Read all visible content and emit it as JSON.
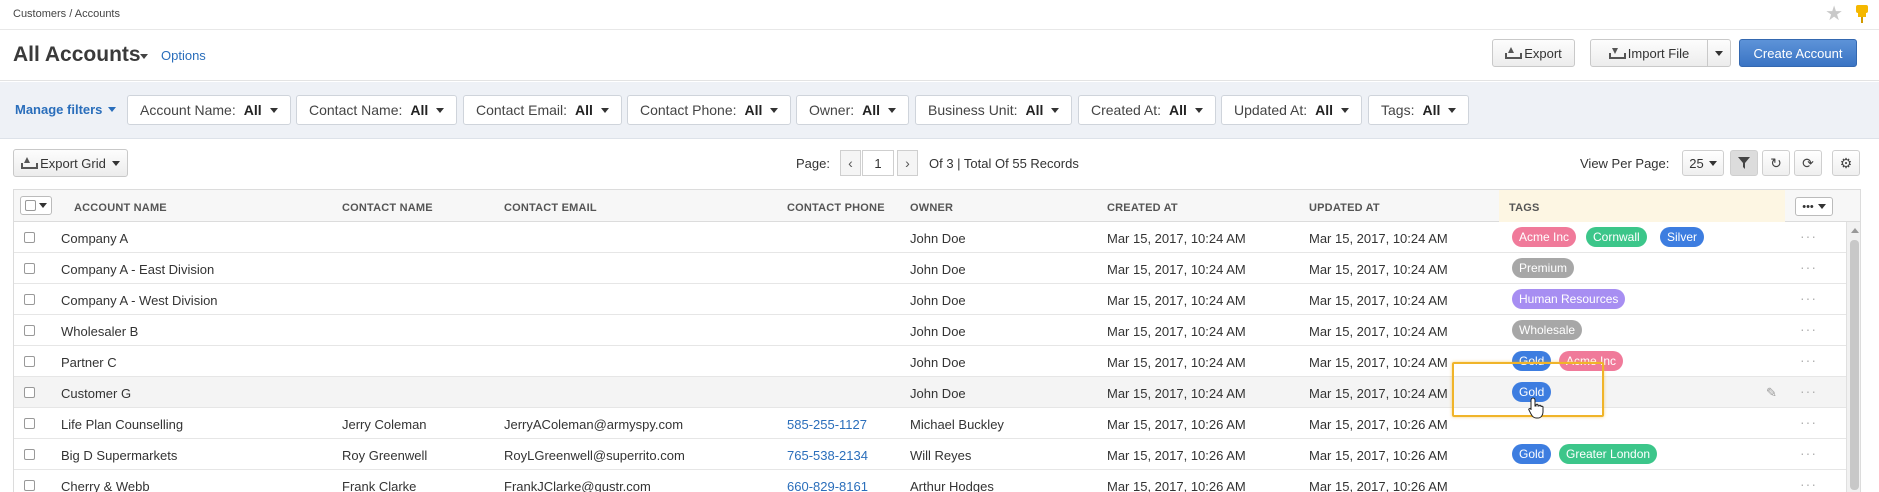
{
  "breadcrumb": "Customers / Accounts",
  "page": {
    "title": "All Accounts",
    "options_label": "Options"
  },
  "actions": {
    "export_label": "Export",
    "import_label": "Import File",
    "create_label": "Create Account"
  },
  "filters": {
    "manage_label": "Manage filters",
    "items": [
      {
        "label": "Account Name:",
        "value": "All"
      },
      {
        "label": "Contact Name:",
        "value": "All"
      },
      {
        "label": "Contact Email:",
        "value": "All"
      },
      {
        "label": "Contact Phone:",
        "value": "All"
      },
      {
        "label": "Owner:",
        "value": "All"
      },
      {
        "label": "Business Unit:",
        "value": "All"
      },
      {
        "label": "Created At:",
        "value": "All"
      },
      {
        "label": "Updated At:",
        "value": "All"
      },
      {
        "label": "Tags:",
        "value": "All"
      }
    ]
  },
  "toolbar": {
    "export_grid_label": "Export Grid",
    "page_label": "Page:",
    "page_value": "1",
    "page_info": "Of 3 | Total Of 55 Records",
    "view_per_page_label": "View Per Page:",
    "view_per_page_value": "25"
  },
  "grid": {
    "columns": [
      "Account Name",
      "Contact Name",
      "Contact Email",
      "Contact Phone",
      "Owner",
      "Created At",
      "Updated At",
      "Tags"
    ],
    "rows": [
      {
        "account": "Company A",
        "contact": "",
        "email": "",
        "phone": "",
        "owner": "John Doe",
        "created": "Mar 15, 2017, 10:24 AM",
        "updated": "Mar 15, 2017, 10:24 AM",
        "tags": [
          {
            "text": "Acme Inc",
            "color": "#f07a9a"
          },
          {
            "text": "Cornwall",
            "color": "#3cc68a"
          },
          {
            "text": "Silver",
            "color": "#3d7de0"
          }
        ]
      },
      {
        "account": "Company A - East Division",
        "contact": "",
        "email": "",
        "phone": "",
        "owner": "John Doe",
        "created": "Mar 15, 2017, 10:24 AM",
        "updated": "Mar 15, 2017, 10:24 AM",
        "tags": [
          {
            "text": "Premium",
            "color": "#a7a7a7"
          }
        ]
      },
      {
        "account": "Company A - West Division",
        "contact": "",
        "email": "",
        "phone": "",
        "owner": "John Doe",
        "created": "Mar 15, 2017, 10:24 AM",
        "updated": "Mar 15, 2017, 10:24 AM",
        "tags": [
          {
            "text": "Human Resources",
            "color": "#a78ef2"
          }
        ]
      },
      {
        "account": "Wholesaler B",
        "contact": "",
        "email": "",
        "phone": "",
        "owner": "John Doe",
        "created": "Mar 15, 2017, 10:24 AM",
        "updated": "Mar 15, 2017, 10:24 AM",
        "tags": [
          {
            "text": "Wholesale",
            "color": "#a7a7a7"
          }
        ]
      },
      {
        "account": "Partner C",
        "contact": "",
        "email": "",
        "phone": "",
        "owner": "John Doe",
        "created": "Mar 15, 2017, 10:24 AM",
        "updated": "Mar 15, 2017, 10:24 AM",
        "tags": [
          {
            "text": "Gold",
            "color": "#3d7de0"
          },
          {
            "text": "Acme Inc",
            "color": "#f07a9a"
          }
        ]
      },
      {
        "account": "Customer G",
        "contact": "",
        "email": "",
        "phone": "",
        "owner": "John Doe",
        "created": "Mar 15, 2017, 10:24 AM",
        "updated": "Mar 15, 2017, 10:24 AM",
        "tags": [
          {
            "text": "Gold",
            "color": "#3d7de0"
          }
        ]
      },
      {
        "account": "Life Plan Counselling",
        "contact": "Jerry Coleman",
        "email": "JerryAColeman@armyspy.com",
        "phone": "585-255-1127",
        "owner": "Michael Buckley",
        "created": "Mar 15, 2017, 10:26 AM",
        "updated": "Mar 15, 2017, 10:26 AM",
        "tags": []
      },
      {
        "account": "Big D Supermarkets",
        "contact": "Roy Greenwell",
        "email": "RoyLGreenwell@superrito.com",
        "phone": "765-538-2134",
        "owner": "Will Reyes",
        "created": "Mar 15, 2017, 10:26 AM",
        "updated": "Mar 15, 2017, 10:26 AM",
        "tags": [
          {
            "text": "Gold",
            "color": "#3d7de0"
          },
          {
            "text": "Greater London",
            "color": "#3cc68a"
          }
        ]
      },
      {
        "account": "Cherry & Webb",
        "contact": "Frank Clarke",
        "email": "FrankJClarke@gustr.com",
        "phone": "660-829-8161",
        "owner": "Arthur Hodges",
        "created": "Mar 15, 2017, 10:26 AM",
        "updated": "Mar 15, 2017, 10:26 AM",
        "tags": []
      }
    ]
  }
}
